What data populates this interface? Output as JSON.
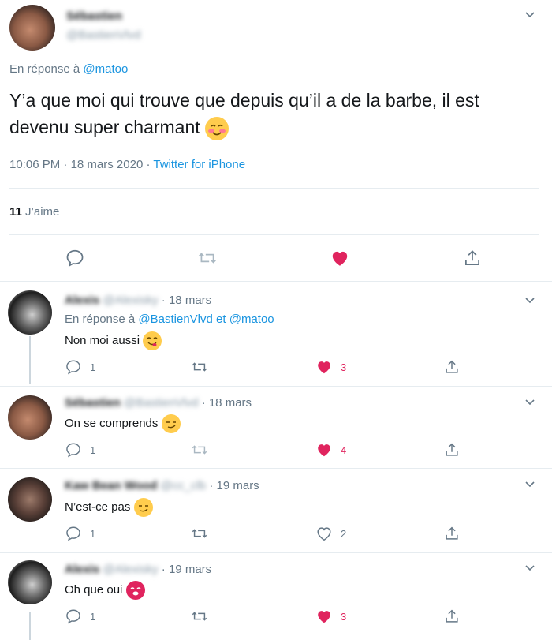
{
  "main_tweet": {
    "author_name": "Sébastien",
    "author_handle": "@BastienVlvd",
    "reply_prefix": "En réponse à ",
    "reply_mention": "@matoo",
    "text": "Y’a que moi qui trouve que depuis qu’il a de la barbe, il est devenu super charmant",
    "time": "10:06 PM",
    "sep": " · ",
    "date": "18 mars 2020",
    "source": "Twitter for iPhone",
    "likes_count": "11",
    "likes_label": "J’aime"
  },
  "replies": [
    {
      "author_name": "Alexis",
      "author_handle": "@Alexisky",
      "date": "18 mars",
      "reply_prefix": "En réponse à ",
      "reply_mention_1": "@BastienVlvd",
      "reply_and": "et",
      "reply_mention_2": "@matoo",
      "text": "Non moi aussi",
      "reply_count": "1",
      "like_count": "3",
      "liked": true
    },
    {
      "author_name": "Sébastien",
      "author_handle": "@BastienVlvd",
      "date": "18 mars",
      "text": "On se comprends",
      "reply_count": "1",
      "like_count": "4",
      "liked": true
    },
    {
      "author_name": "Kaw Bean Wood",
      "author_handle": "@cc_clb",
      "date": "19 mars",
      "text": "N’est-ce pas",
      "reply_count": "1",
      "like_count": "2",
      "liked": false
    },
    {
      "author_name": "Alexis",
      "author_handle": "@Alexisky",
      "date": "19 mars",
      "text": "Oh que oui",
      "reply_count": "1",
      "like_count": "3",
      "liked": true
    }
  ],
  "icons": {
    "reply": "speech-bubble-icon",
    "retweet": "retweet-icon",
    "like": "heart-icon",
    "share": "share-icon",
    "menu": "chevron-down-icon"
  },
  "colors": {
    "accent": "#1b95e0",
    "like": "#e0245e",
    "secondary_text": "#657786",
    "divider": "#e6ecf0"
  }
}
